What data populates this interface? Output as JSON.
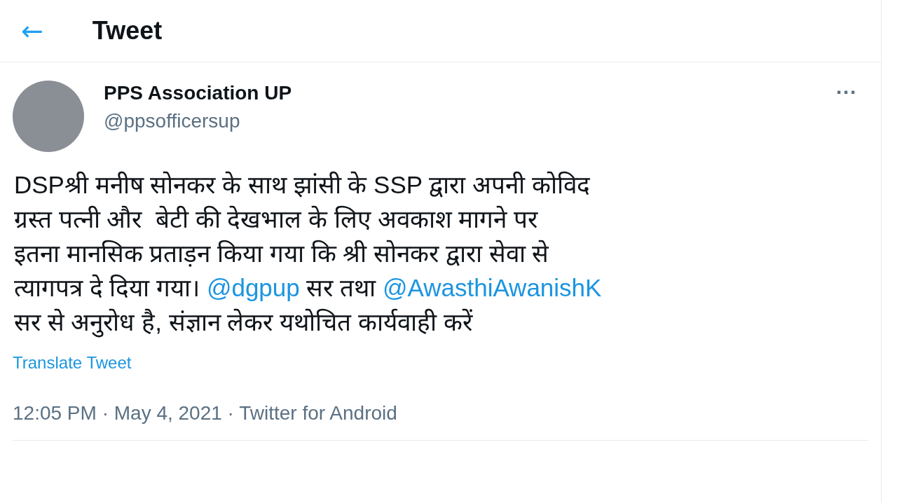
{
  "header": {
    "back": "←",
    "title": "Tweet"
  },
  "tweet": {
    "author": "PPS Association UP",
    "handle": "@ppsofficersup",
    "more": "···",
    "body_lines": [
      [
        {
          "kind": "text",
          "text": "DSPश्री मनीष सोनकर के साथ झांसी के SSP द्वारा अपनी कोविद"
        }
      ],
      [
        {
          "kind": "text",
          "text": "ग्रस्त पत्नी और  बेटी की देखभाल के लिए अवकाश मागने पर"
        }
      ],
      [
        {
          "kind": "text",
          "text": "इतना मानसिक प्रताड़न किया गया कि श्री सोनकर द्वारा सेवा से"
        }
      ],
      [
        {
          "kind": "text",
          "text": "त्यागपत्र दे दिया गया। "
        },
        {
          "kind": "mention",
          "text": "@dgpup"
        },
        {
          "kind": "text",
          "text": " सर तथा "
        },
        {
          "kind": "mention",
          "text": "@AwasthiAwanishK"
        }
      ],
      [
        {
          "kind": "text",
          "text": "सर से अनुरोध है, संज्ञान लेकर यथोचित कार्यवाही करें"
        }
      ]
    ],
    "translate": "Translate Tweet",
    "meta": "12:05 PM · May 4, 2021 · Twitter for Android"
  }
}
